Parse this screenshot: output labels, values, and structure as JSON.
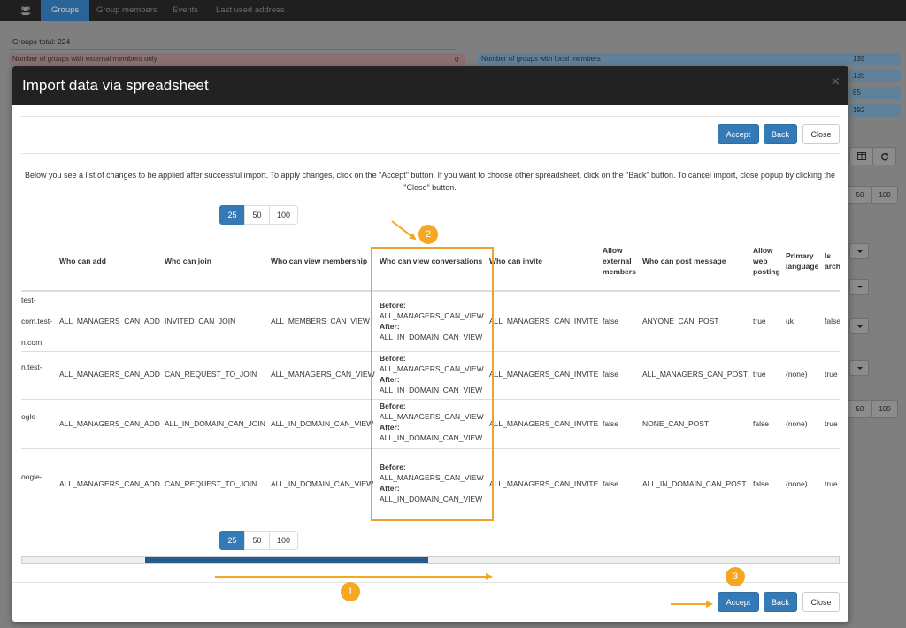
{
  "navbar": {
    "brand_icon": "users-icon",
    "items": [
      {
        "label": "Groups",
        "active": true
      },
      {
        "label": "Group members",
        "active": false
      },
      {
        "label": "Events",
        "active": false
      },
      {
        "label": "Last used address",
        "active": false
      }
    ]
  },
  "background": {
    "groups_total": "Groups total: 224",
    "external_only_label": "Number of groups with external members only",
    "external_only_value": "0",
    "local_label": "Number of groups with local members",
    "side_values": [
      "139",
      "135",
      "85",
      "192"
    ],
    "page_size_buttons": [
      "50",
      "100"
    ],
    "page_size_buttons_2": [
      "50",
      "100"
    ]
  },
  "modal": {
    "title": "Import data via spreadsheet",
    "close_symbol": "×",
    "accept_label": "Accept",
    "back_label": "Back",
    "close_label": "Close",
    "intro_text": "Below you see a list of changes to be applied after successful import. To apply changes, click on the \"Accept\" button. If you want to choose other spreadsheet, click on the \"Back\" button. To cancel import, close popup by clicking the \"Close\" button.",
    "page_sizes": [
      "25",
      "50",
      "100"
    ],
    "active_page_size": "25",
    "table": {
      "headers": {
        "who_can_add": "Who can add",
        "who_can_join": "Who can join",
        "who_can_view_membership": "Who can view membership",
        "who_can_view_conversations": "Who can view conversations",
        "who_can_invite": "Who can invite",
        "allow_external_1": "Allow",
        "allow_external_2": "external",
        "allow_external_3": "members",
        "who_can_post": "Who can post message",
        "allow_web_1": "Allow",
        "allow_web_2": "web",
        "allow_web_3": "posting",
        "primary_language_1": "Primary",
        "primary_language_2": "language",
        "is_archived_1": "Is",
        "is_archived_2": "arch"
      },
      "rows": [
        {
          "email_1": "test-",
          "email_2": "com.test-",
          "email_3": "n.com",
          "who_can_add": "ALL_MANAGERS_CAN_ADD",
          "who_can_join": "INVITED_CAN_JOIN",
          "who_can_view_membership": "ALL_MEMBERS_CAN_VIEW",
          "before_label": "Before:",
          "before_value": "ALL_MANAGERS_CAN_VIEW",
          "after_label": "After:",
          "after_value": "ALL_IN_DOMAIN_CAN_VIEW",
          "who_can_invite": "ALL_MANAGERS_CAN_INVITE",
          "allow_external": "false",
          "who_can_post": "ANYONE_CAN_POST",
          "allow_web": "true",
          "primary_language": "uk",
          "is_archived": "false"
        },
        {
          "email_1": "n.test-",
          "who_can_add": "ALL_MANAGERS_CAN_ADD",
          "who_can_join": "CAN_REQUEST_TO_JOIN",
          "who_can_view_membership": "ALL_MANAGERS_CAN_VIEW",
          "before_label": "Before:",
          "before_value": "ALL_MANAGERS_CAN_VIEW",
          "after_label": "After:",
          "after_value": "ALL_IN_DOMAIN_CAN_VIEW",
          "who_can_invite": "ALL_MANAGERS_CAN_INVITE",
          "allow_external": "false",
          "who_can_post": "ALL_MANAGERS_CAN_POST",
          "allow_web": "true",
          "primary_language": "(none)",
          "is_archived": "true"
        },
        {
          "email_1": "ogle-",
          "who_can_add": "ALL_MANAGERS_CAN_ADD",
          "who_can_join": "ALL_IN_DOMAIN_CAN_JOIN",
          "who_can_view_membership": "ALL_IN_DOMAIN_CAN_VIEW",
          "before_label": "Before:",
          "before_value": "ALL_MANAGERS_CAN_VIEW",
          "after_label": "After:",
          "after_value": "ALL_IN_DOMAIN_CAN_VIEW",
          "who_can_invite": "ALL_MANAGERS_CAN_INVITE",
          "allow_external": "false",
          "who_can_post": "NONE_CAN_POST",
          "allow_web": "false",
          "primary_language": "(none)",
          "is_archived": "true"
        },
        {
          "email_1": "oogle-",
          "who_can_add": "ALL_MANAGERS_CAN_ADD",
          "who_can_join": "CAN_REQUEST_TO_JOIN",
          "who_can_view_membership": "ALL_IN_DOMAIN_CAN_VIEW",
          "before_label": "Before:",
          "before_value": "ALL_MANAGERS_CAN_VIEW",
          "after_label": "After:",
          "after_value": "ALL_IN_DOMAIN_CAN_VIEW",
          "who_can_invite": "ALL_MANAGERS_CAN_INVITE",
          "allow_external": "false",
          "who_can_post": "ALL_IN_DOMAIN_CAN_POST",
          "allow_web": "false",
          "primary_language": "(none)",
          "is_archived": "true"
        }
      ]
    },
    "horizontal_scroll_position": 0.23
  },
  "annotations": {
    "step_1": "1",
    "step_2": "2",
    "step_3": "3",
    "color": "#f5a623"
  }
}
